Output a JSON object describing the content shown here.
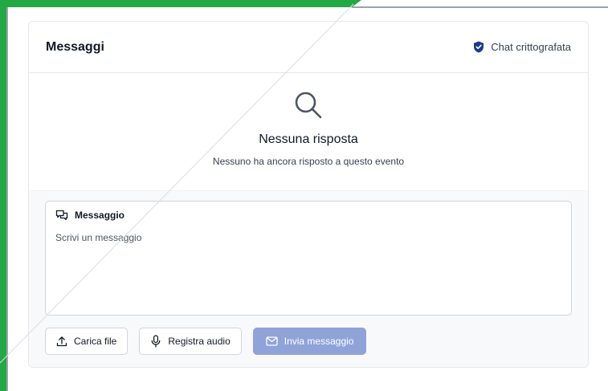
{
  "messages": {
    "title": "Messaggi",
    "encryption_label": "Chat crittografata",
    "encryption_icon": "shield-check-icon"
  },
  "empty_state": {
    "icon": "search-icon",
    "title": "Nessuna risposta",
    "subtitle": "Nessuno ha ancora risposto a questo evento"
  },
  "composer": {
    "label": "Messaggio",
    "label_icon": "chat-bubbles-icon",
    "placeholder": "Scrivi un messaggio",
    "upload_label": "Carica file",
    "upload_icon": "upload-icon",
    "record_label": "Registra audio",
    "record_icon": "microphone-icon",
    "send_label": "Invia messaggio",
    "send_icon": "envelope-icon"
  },
  "colors": {
    "frame_green": "#22a845",
    "send_button": "#8fa3d9",
    "shield": "#1e3a8a"
  }
}
